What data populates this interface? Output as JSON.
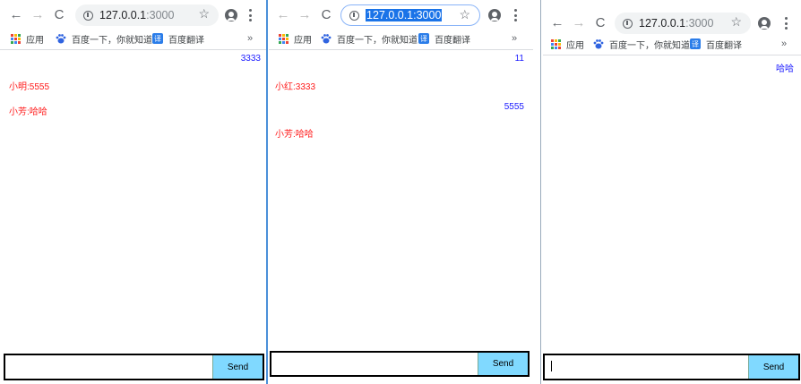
{
  "browser": {
    "url_host": "127.0.0.1",
    "url_port": ":3000",
    "url_full": "127.0.0.1:3000",
    "nav_icons": [
      "back-arrow-icon",
      "forward-arrow-icon",
      "reload-icon"
    ],
    "bookmarks": [
      {
        "icon": "apps-grid-icon",
        "label": "应用"
      },
      {
        "icon": "baidu-paw-icon",
        "label": "百度一下，你就知道"
      },
      {
        "icon": "baidu-translate-icon",
        "label": "百度翻译"
      }
    ],
    "overflow": "»",
    "star_icon": "☆",
    "translate_icon_char": "译"
  },
  "windows": [
    {
      "messages": [
        {
          "side": "right",
          "text": "3333"
        },
        {
          "side": "left",
          "text": "小明:5555"
        },
        {
          "side": "left",
          "text": "小芳:哈哈"
        }
      ],
      "input_value": "",
      "send_label": "Send"
    },
    {
      "messages": [
        {
          "side": "right",
          "text": "11"
        },
        {
          "side": "left",
          "text": "小红:3333"
        },
        {
          "side": "right",
          "text": "5555"
        },
        {
          "side": "left",
          "text": "小芳:哈哈"
        }
      ],
      "input_value": "",
      "send_label": "Send"
    },
    {
      "messages": [
        {
          "side": "right",
          "text": "哈哈"
        }
      ],
      "input_value": "",
      "send_label": "Send"
    }
  ],
  "colors": {
    "left_message": "#ff1a1a",
    "right_message": "#1a1aff",
    "send_button": "#80d9ff",
    "divider": "#4a90d9"
  }
}
